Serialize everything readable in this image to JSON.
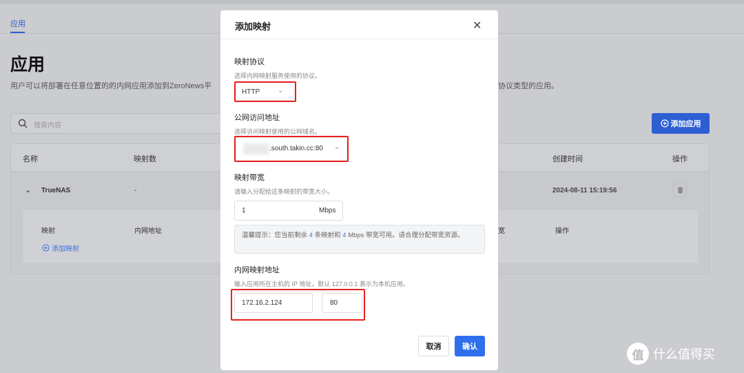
{
  "page": {
    "tab": "应用",
    "title": "应用",
    "description": "用户可以将部署在任意位置的的内网应用添加到ZeroNews平",
    "description_tail": "协议类型的应用。",
    "search_placeholder": "搜索内容",
    "add_app_label": "添加应用",
    "table": {
      "headers": [
        "名称",
        "映射数",
        "创建时间",
        "操作"
      ],
      "rows": [
        {
          "name": "TrueNAS",
          "mappings": "-",
          "created": "2024-08-11 15:19:56"
        }
      ],
      "sub_headers": [
        "映射",
        "内网地址",
        "宽",
        "操作"
      ],
      "add_mapping_label": "添加映射"
    }
  },
  "modal": {
    "title": "添加映射",
    "protocol": {
      "label": "映射协议",
      "hint": "选择内网映射服务使用的协议。",
      "value": "HTTP"
    },
    "public_address": {
      "label": "公网访问地址",
      "hint": "选择访问映射使用的公网域名。",
      "value": ".south.takin.cc:80"
    },
    "bandwidth": {
      "label": "映射带宽",
      "hint": "请输入分配给这条映射的带宽大小。",
      "value": "1",
      "unit": "Mbps"
    },
    "tip": {
      "prefix": "温馨提示：您当前剩余",
      "mappings": "4",
      "mid": "条映射和",
      "mbps": "4",
      "suffix": "Mbps 带宽可用。请合理分配带宽资源。"
    },
    "internal_address": {
      "label": "内网映射地址",
      "hint": "输入应用所在主机的 IP 地址，默认 127.0.0.1 表示为本机应用。",
      "ip": "172.16.2.124",
      "port": "80"
    },
    "cancel_label": "取消",
    "confirm_label": "确认"
  },
  "watermark": {
    "logo": "值",
    "text": "什么值得买"
  },
  "colors": {
    "accent": "#2d5fd3",
    "highlight": "#e8201c"
  }
}
